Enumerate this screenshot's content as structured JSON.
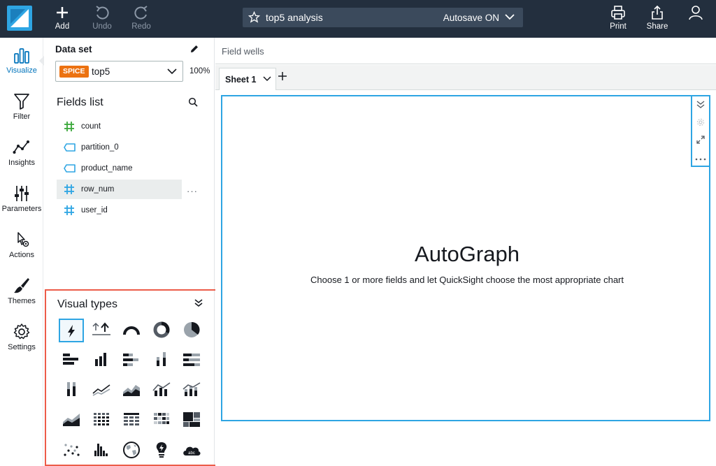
{
  "toolbar": {
    "add_label": "Add",
    "undo_label": "Undo",
    "redo_label": "Redo",
    "print_label": "Print",
    "share_label": "Share"
  },
  "analysis": {
    "name": "top5 analysis",
    "autosave": "Autosave ON"
  },
  "rail": {
    "items": [
      {
        "label": "Visualize",
        "icon": "bar-chart-icon",
        "active": true
      },
      {
        "label": "Filter",
        "icon": "funnel-icon"
      },
      {
        "label": "Insights",
        "icon": "insights-line-icon"
      },
      {
        "label": "Parameters",
        "icon": "sliders-icon"
      },
      {
        "label": "Actions",
        "icon": "pointer-gear-icon"
      },
      {
        "label": "Themes",
        "icon": "brush-icon"
      },
      {
        "label": "Settings",
        "icon": "gear-icon"
      }
    ]
  },
  "dataset": {
    "label": "Data set",
    "badge": "SPICE",
    "name": "top5",
    "percent": "100%"
  },
  "fields": {
    "title": "Fields list",
    "items": [
      {
        "name": "count",
        "type": "measure"
      },
      {
        "name": "partition_0",
        "type": "dimension"
      },
      {
        "name": "product_name",
        "type": "dimension"
      },
      {
        "name": "row_num",
        "type": "dimension-number"
      },
      {
        "name": "user_id",
        "type": "dimension-number"
      }
    ],
    "more": "···"
  },
  "visual_types": {
    "title": "Visual types",
    "items": [
      "autograph",
      "kpi",
      "gauge",
      "donut",
      "pie",
      "horizontal-bar",
      "vertical-bar",
      "horizontal-stacked-bar",
      "vertical-stacked-bar",
      "horizontal-100-bar",
      "vertical-100-bar",
      "line",
      "area-line",
      "combo-bar-line",
      "combo-stacked-line",
      "stacked-area",
      "pivot-table",
      "table",
      "heat-map",
      "tree-map",
      "scatter",
      "histogram",
      "geo-map",
      "insight",
      "word-cloud"
    ]
  },
  "workspace": {
    "field_wells": "Field wells",
    "sheet_name": "Sheet 1",
    "autograph_title": "AutoGraph",
    "autograph_subtitle": "Choose 1 or more fields and let QuickSight choose the most appropriate chart"
  },
  "colors": {
    "topbar": "#232f3e",
    "accent": "#2ea5e3",
    "spice": "#ec7211",
    "highlight_box": "#ec5c49",
    "measure_green": "#3aa83a",
    "dimension_blue": "#2ea5e3"
  }
}
